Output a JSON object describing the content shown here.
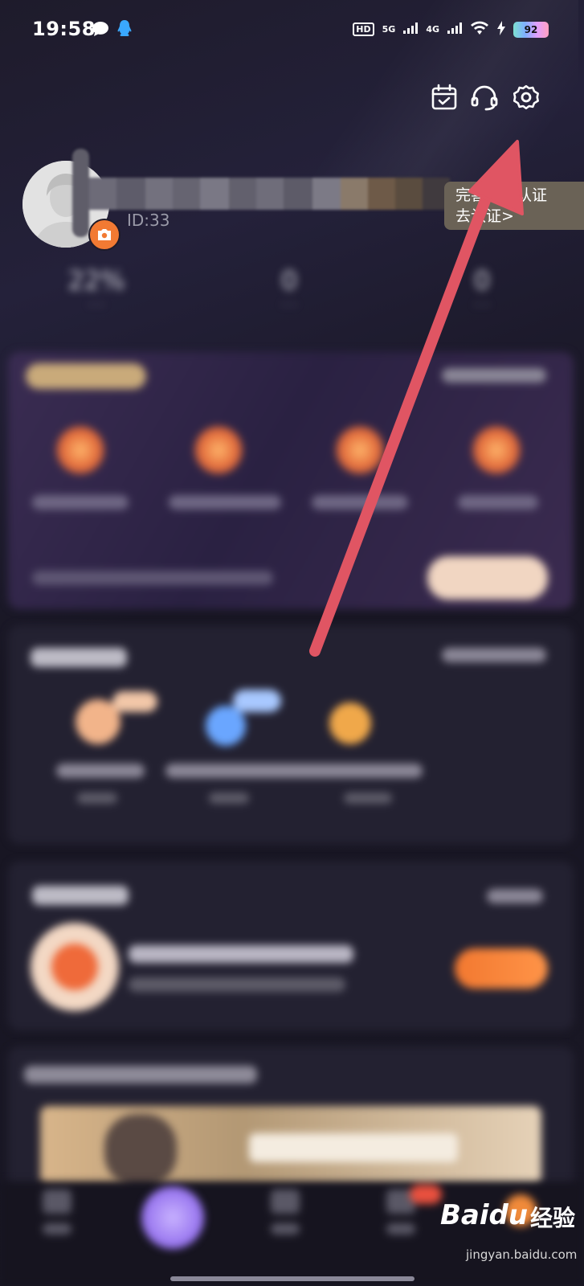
{
  "status_bar": {
    "time": "19:58",
    "battery": "92",
    "network_labels": [
      "HD",
      "5G",
      "4G"
    ]
  },
  "header_icons": [
    "calendar-check-icon",
    "headset-icon",
    "settings-gear-icon"
  ],
  "profile": {
    "id_prefix": "ID:33",
    "verify_line1": "完善实名认证",
    "verify_line2": "去认证>"
  },
  "watermark": {
    "logo": "Baidu",
    "chinese": "经验",
    "url": "jingyan.baidu.com"
  },
  "colors": {
    "background": "#191725",
    "accent_orange": "#f27a33",
    "annotation_arrow": "#e05563",
    "center_button": "#9a78f0"
  }
}
